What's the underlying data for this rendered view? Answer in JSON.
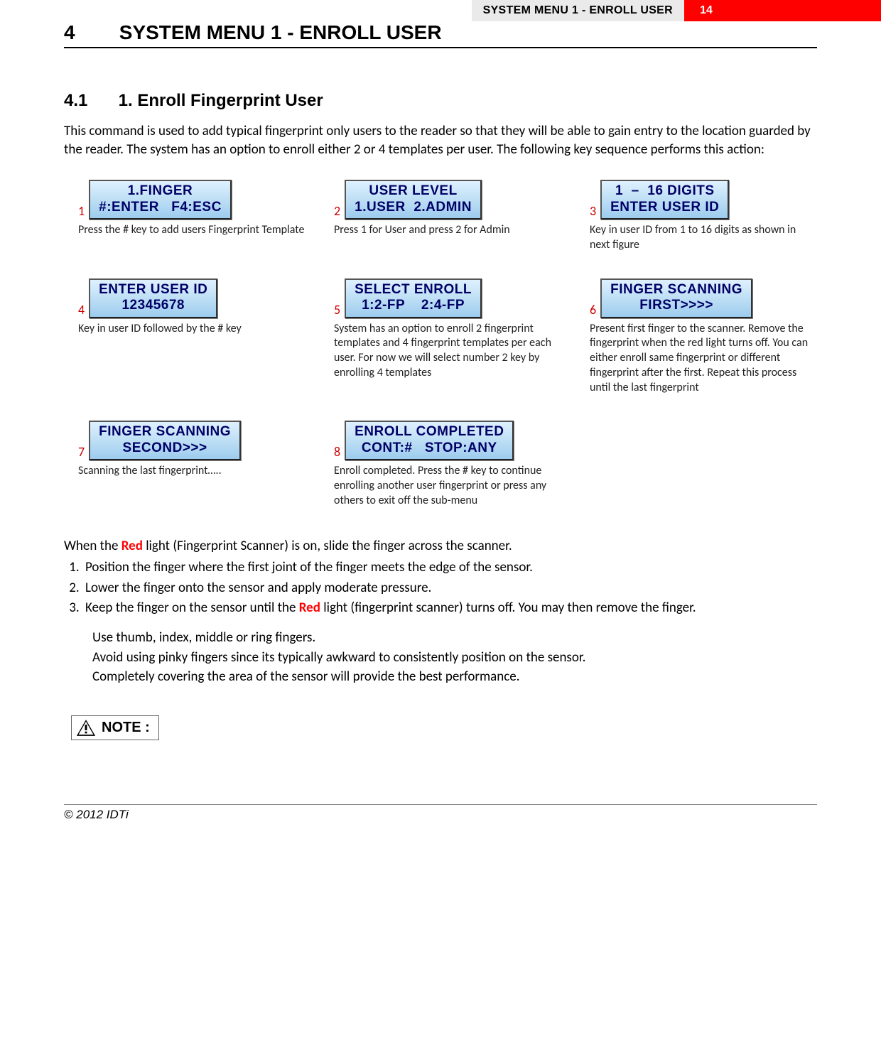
{
  "header": {
    "section_title": "SYSTEM MENU 1 - ENROLL USER",
    "page_number": "14"
  },
  "chapter": {
    "number": "4",
    "title": "SYSTEM MENU 1 - ENROLL USER"
  },
  "section": {
    "number": "4.1",
    "title": "1. Enroll Fingerprint User"
  },
  "intro_paragraph": "This command is used to add typical fingerprint only users to the reader so that they will be able to gain entry to the location guarded by the reader. The system has an option to enroll either 2 or 4 templates per user. The following key sequence performs this action:",
  "steps": [
    {
      "num": "1",
      "lcd_line1": "1.FINGER",
      "lcd_line2": "#:ENTER   F4:ESC",
      "caption": "Press the # key to add users Fingerprint Template"
    },
    {
      "num": "2",
      "lcd_line1": "USER LEVEL",
      "lcd_line2": "1.USER  2.ADMIN",
      "caption": "Press 1 for User and press 2 for Admin"
    },
    {
      "num": "3",
      "lcd_line1": "1  –  16 DIGITS",
      "lcd_line2": "ENTER USER ID",
      "caption": "Key in user ID from 1 to 16 digits as shown in next figure"
    },
    {
      "num": "4",
      "lcd_line1": "ENTER USER ID",
      "lcd_line2": "12345678",
      "caption": "Key in user ID followed by the # key"
    },
    {
      "num": "5",
      "lcd_line1": "SELECT ENROLL",
      "lcd_line2": "1:2-FP    2:4-FP",
      "caption": "System has an option to enroll 2 fingerprint templates and 4 fingerprint templates per each user. For now we will select number 2 key by enrolling 4 templates"
    },
    {
      "num": "6",
      "lcd_line1": "FINGER SCANNING",
      "lcd_line2": "FIRST>>>>",
      "caption": "Present first finger to the scanner. Remove the fingerprint when the red light turns off.  You can either enroll same fingerprint or different fingerprint after the first. Repeat this process until the last fingerprint"
    },
    {
      "num": "7",
      "lcd_line1": "FINGER SCANNING",
      "lcd_line2": "SECOND>>>",
      "caption": "Scanning the last fingerprint….."
    },
    {
      "num": "8",
      "lcd_line1": "ENROLL COMPLETED",
      "lcd_line2": "CONT:#   STOP:ANY",
      "caption": "Enroll completed. Press the # key to continue enrolling another user fingerprint or press any others to exit off the sub-menu"
    }
  ],
  "after": {
    "line1_pre": "When the ",
    "line1_red": "Red",
    "line1_post": " light (Fingerprint Scanner) is on, slide the finger across the scanner.",
    "ol": [
      "Position the finger where the first joint of the finger meets the edge of the sensor.",
      "Lower the finger onto the sensor and apply moderate pressure."
    ],
    "ol3_pre": "Keep the finger on the sensor until the ",
    "ol3_red": "Red",
    "ol3_post": " light (fingerprint scanner) turns off. You may then remove the finger.",
    "tips": [
      "Use thumb, index, middle or ring fingers.",
      "Avoid using pinky fingers since its typically awkward to consistently position on the sensor.",
      "Completely covering the area of the sensor will provide the best performance."
    ]
  },
  "note_label": "NOTE :",
  "footer": "© 2012 IDTi"
}
